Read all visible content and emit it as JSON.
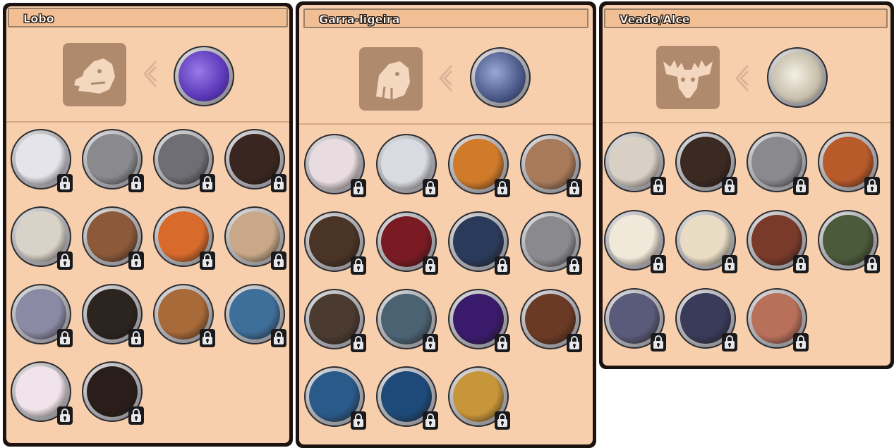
{
  "panels": [
    {
      "title": "Lobo",
      "base_icon": "wolf-silhouette-icon",
      "featured_color": "#6a48c8",
      "skins": [
        {
          "color": "#e4e4ea",
          "locked": true
        },
        {
          "color": "#8a8a8e",
          "locked": true
        },
        {
          "color": "#6e6e74",
          "locked": true
        },
        {
          "color": "#3a2620",
          "locked": true
        },
        {
          "color": "#d8d2c8",
          "locked": true
        },
        {
          "color": "#8c5a3a",
          "locked": true
        },
        {
          "color": "#d86a2c",
          "locked": true
        },
        {
          "color": "#c8a888",
          "locked": true
        },
        {
          "color": "#8a8aa4",
          "locked": true
        },
        {
          "color": "#2c241e",
          "locked": true
        },
        {
          "color": "#a86a38",
          "locked": true
        },
        {
          "color": "#3e6e9a",
          "locked": true
        },
        {
          "color": "#f0e4ea",
          "locked": true
        },
        {
          "color": "#2a1e1a",
          "locked": true
        }
      ]
    },
    {
      "title": "Garra-ligeira",
      "base_icon": "sabertooth-silhouette-icon",
      "featured_color": "#5a6898",
      "skins": [
        {
          "color": "#e8dce0",
          "locked": true
        },
        {
          "color": "#d8dce2",
          "locked": true
        },
        {
          "color": "#d07a2a",
          "locked": true
        },
        {
          "color": "#a87a5a",
          "locked": true
        },
        {
          "color": "#4a3426",
          "locked": true
        },
        {
          "color": "#7a1a22",
          "locked": true
        },
        {
          "color": "#2a3a5a",
          "locked": true
        },
        {
          "color": "#8a8a8e",
          "locked": true
        },
        {
          "color": "#4a3a30",
          "locked": true
        },
        {
          "color": "#4a6272",
          "locked": true
        },
        {
          "color": "#3a1a6a",
          "locked": true
        },
        {
          "color": "#6a3a24",
          "locked": true
        },
        {
          "color": "#2a5a8a",
          "locked": true
        },
        {
          "color": "#1e4a7a",
          "locked": true
        },
        {
          "color": "#c8963a",
          "locked": true
        }
      ]
    },
    {
      "title": "Veado/Alce",
      "base_icon": "moose-silhouette-icon",
      "featured_color": "#e8e0d0",
      "skins": [
        {
          "color": "#d8d0c4",
          "locked": true
        },
        {
          "color": "#3a2a22",
          "locked": true
        },
        {
          "color": "#8a8a8e",
          "locked": true
        },
        {
          "color": "#b85a2a",
          "locked": true
        },
        {
          "color": "#f0e8d8",
          "locked": true
        },
        {
          "color": "#e8dcc4",
          "locked": true
        },
        {
          "color": "#7a3a2a",
          "locked": true
        },
        {
          "color": "#4a5a3a",
          "locked": true
        },
        {
          "color": "#5a5a7a",
          "locked": true
        },
        {
          "color": "#3a3a5a",
          "locked": true
        },
        {
          "color": "#b8705a",
          "locked": true
        }
      ]
    }
  ]
}
